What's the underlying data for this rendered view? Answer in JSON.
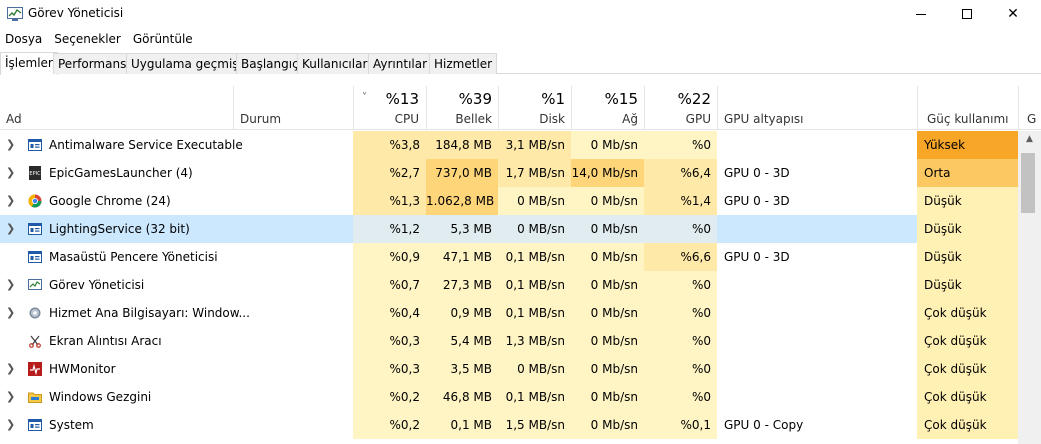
{
  "window": {
    "title": "Görev Yöneticisi",
    "minimize_icon": "minimize-icon",
    "maximize_icon": "maximize-icon",
    "close_icon": "close-icon",
    "close_glyph": "✕"
  },
  "menu": [
    "Dosya",
    "Seçenekler",
    "Görüntüle"
  ],
  "tabs": [
    {
      "label": "İşlemler",
      "active": true
    },
    {
      "label": "Performans",
      "active": false
    },
    {
      "label": "Uygulama geçmişi",
      "active": false
    },
    {
      "label": "Başlangıç",
      "active": false
    },
    {
      "label": "Kullanıcılar",
      "active": false
    },
    {
      "label": "Ayrıntılar",
      "active": false
    },
    {
      "label": "Hizmetler",
      "active": false
    }
  ],
  "columns": {
    "name": "Ad",
    "status": "Durum",
    "cpu": {
      "pct": "%13",
      "label": "CPU"
    },
    "memory": {
      "pct": "%39",
      "label": "Bellek"
    },
    "disk": {
      "pct": "%1",
      "label": "Disk"
    },
    "network": {
      "pct": "%15",
      "label": "Ağ"
    },
    "gpu": {
      "pct": "%22",
      "label": "GPU"
    },
    "gpu_engine": "GPU altyapısı",
    "power": "Güç kullanımı",
    "power_trend": "G",
    "sort_indicator": "˅"
  },
  "processes": [
    {
      "name": "Antimalware Service Executable",
      "expandable": true,
      "icon": "service-window-icon",
      "cpu": "%3,8",
      "memory": "184,8 MB",
      "disk": "3,1 MB/sn",
      "network": "0 Mb/sn",
      "gpu": "%0",
      "gpu_engine": "",
      "power": "Yüksek",
      "selected": false
    },
    {
      "name": "EpicGamesLauncher (4)",
      "expandable": true,
      "icon": "epic-games-icon",
      "cpu": "%2,7",
      "memory": "737,0 MB",
      "disk": "1,7 MB/sn",
      "network": "14,0 Mb/sn",
      "gpu": "%6,4",
      "gpu_engine": "GPU 0 - 3D",
      "power": "Orta",
      "selected": false
    },
    {
      "name": "Google Chrome (24)",
      "expandable": true,
      "icon": "chrome-icon",
      "cpu": "%1,3",
      "memory": "1.062,8 MB",
      "disk": "0 MB/sn",
      "network": "0 Mb/sn",
      "gpu": "%1,4",
      "gpu_engine": "GPU 0 - 3D",
      "power": "Düşük",
      "selected": false
    },
    {
      "name": "LightingService (32 bit)",
      "expandable": true,
      "icon": "service-window-icon",
      "cpu": "%1,2",
      "memory": "5,3 MB",
      "disk": "0 MB/sn",
      "network": "0 Mb/sn",
      "gpu": "%0",
      "gpu_engine": "",
      "power": "Düşük",
      "selected": true
    },
    {
      "name": "Masaüstü Pencere Yöneticisi",
      "expandable": false,
      "icon": "service-window-icon",
      "cpu": "%0,9",
      "memory": "47,1 MB",
      "disk": "0,1 MB/sn",
      "network": "0 Mb/sn",
      "gpu": "%6,6",
      "gpu_engine": "GPU 0 - 3D",
      "power": "Düşük",
      "selected": false
    },
    {
      "name": "Görev Yöneticisi",
      "expandable": true,
      "icon": "task-manager-icon",
      "cpu": "%0,7",
      "memory": "27,3 MB",
      "disk": "0,1 MB/sn",
      "network": "0 Mb/sn",
      "gpu": "%0",
      "gpu_engine": "",
      "power": "Düşük",
      "selected": false
    },
    {
      "name": "Hizmet Ana Bilgisayarı: Window...",
      "expandable": true,
      "icon": "gear-icon",
      "cpu": "%0,4",
      "memory": "0,9 MB",
      "disk": "0,1 MB/sn",
      "network": "0 Mb/sn",
      "gpu": "%0",
      "gpu_engine": "",
      "power": "Çok düşük",
      "selected": false
    },
    {
      "name": "Ekran Alıntısı Aracı",
      "expandable": false,
      "icon": "scissors-icon",
      "cpu": "%0,3",
      "memory": "5,4 MB",
      "disk": "1,3 MB/sn",
      "network": "0 Mb/sn",
      "gpu": "%0",
      "gpu_engine": "",
      "power": "Çok düşük",
      "selected": false
    },
    {
      "name": "HWMonitor",
      "expandable": true,
      "icon": "hwmonitor-icon",
      "cpu": "%0,3",
      "memory": "3,5 MB",
      "disk": "0 MB/sn",
      "network": "0 Mb/sn",
      "gpu": "%0",
      "gpu_engine": "",
      "power": "Çok düşük",
      "selected": false
    },
    {
      "name": "Windows Gezgini",
      "expandable": true,
      "icon": "folder-icon",
      "cpu": "%0,2",
      "memory": "46,8 MB",
      "disk": "0,1 MB/sn",
      "network": "0 Mb/sn",
      "gpu": "%0",
      "gpu_engine": "",
      "power": "Çok düşük",
      "selected": false
    },
    {
      "name": "System",
      "expandable": true,
      "icon": "service-window-icon",
      "cpu": "%0,2",
      "memory": "0,1 MB",
      "disk": "1,5 MB/sn",
      "network": "0 Mb/sn",
      "gpu": "%0,1",
      "gpu_engine": "GPU 0 - Copy",
      "power": "Çok düşük",
      "selected": false
    }
  ],
  "heat_colors": {
    "light": "#fff4c4",
    "medium": "#ffe9a8",
    "warm": "#ffd57a",
    "power_high": "#f8a628",
    "power_medium": "#fcc862",
    "power_low": "#fff0b4",
    "selection": "#cce8ff"
  },
  "metric_heat": [
    {
      "cpu": "medium",
      "memory": "medium",
      "disk": "medium",
      "network": "light",
      "gpu": "light"
    },
    {
      "cpu": "medium",
      "memory": "warm",
      "disk": "medium",
      "network": "warm",
      "gpu": "medium"
    },
    {
      "cpu": "medium",
      "memory": "warm",
      "disk": "light",
      "network": "light",
      "gpu": "medium"
    },
    {
      "cpu": "medium",
      "memory": "light",
      "disk": "light",
      "network": "light",
      "gpu": "light"
    },
    {
      "cpu": "light",
      "memory": "light",
      "disk": "light",
      "network": "light",
      "gpu": "medium"
    },
    {
      "cpu": "light",
      "memory": "light",
      "disk": "light",
      "network": "light",
      "gpu": "light"
    },
    {
      "cpu": "light",
      "memory": "light",
      "disk": "light",
      "network": "light",
      "gpu": "light"
    },
    {
      "cpu": "light",
      "memory": "light",
      "disk": "light",
      "network": "light",
      "gpu": "light"
    },
    {
      "cpu": "light",
      "memory": "light",
      "disk": "light",
      "network": "light",
      "gpu": "light"
    },
    {
      "cpu": "light",
      "memory": "light",
      "disk": "light",
      "network": "light",
      "gpu": "light"
    },
    {
      "cpu": "light",
      "memory": "light",
      "disk": "light",
      "network": "light",
      "gpu": "light"
    }
  ]
}
